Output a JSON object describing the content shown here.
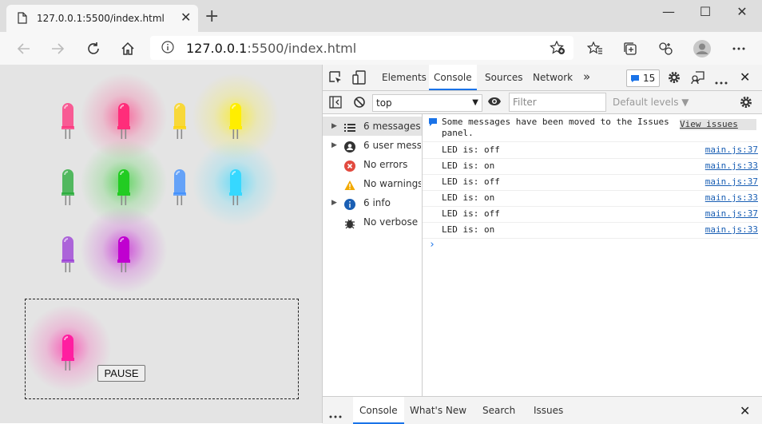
{
  "browser": {
    "tab_title": "127.0.0.1:5500/index.html",
    "url_host": "127.0.0.1",
    "url_rest": ":5500/index.html"
  },
  "page": {
    "pause_label": "PAUSE",
    "leds": [
      {
        "color": "#ff2d7a",
        "on": false
      },
      {
        "color": "#ff2d7a",
        "on": true
      },
      {
        "color": "#ffd400",
        "on": false
      },
      {
        "color": "#ffee00",
        "on": true
      },
      {
        "color": "#22aa33",
        "on": false
      },
      {
        "color": "#22cc22",
        "on": true
      },
      {
        "color": "#3a8cff",
        "on": false
      },
      {
        "color": "#36d8ff",
        "on": true
      },
      {
        "color": "#9a3ad6",
        "on": false
      },
      {
        "color": "#c000d0",
        "on": true
      },
      {
        "color": "#ff1ea0",
        "on": true
      }
    ]
  },
  "devtools": {
    "tabs": [
      "Elements",
      "Console",
      "Sources",
      "Network"
    ],
    "issues_count": "15",
    "context": "top",
    "filter_placeholder": "Filter",
    "levels": "Default levels ▼",
    "sidebar": [
      {
        "label": "6 messages",
        "icon": "list-icon",
        "expandable": true
      },
      {
        "label": "6 user mess…",
        "icon": "user-icon",
        "expandable": true
      },
      {
        "label": "No errors",
        "icon": "error-icon",
        "expandable": false
      },
      {
        "label": "No warnings",
        "icon": "warning-icon",
        "expandable": false
      },
      {
        "label": "6 info",
        "icon": "info-icon",
        "expandable": true
      },
      {
        "label": "No verbose",
        "icon": "bug-icon",
        "expandable": false
      }
    ],
    "issues_notice": {
      "line1": "Some messages have been moved to the Issues",
      "line2": "panel.",
      "link": "View issues"
    },
    "messages": [
      {
        "text": "LED is: off",
        "source": "main.js:37"
      },
      {
        "text": "LED is: on",
        "source": "main.js:33"
      },
      {
        "text": "LED is: off",
        "source": "main.js:37"
      },
      {
        "text": "LED is: on",
        "source": "main.js:33"
      },
      {
        "text": "LED is: off",
        "source": "main.js:37"
      },
      {
        "text": "LED is: on",
        "source": "main.js:33"
      }
    ],
    "drawer_tabs": [
      "Console",
      "What's New",
      "Search",
      "Issues"
    ]
  }
}
